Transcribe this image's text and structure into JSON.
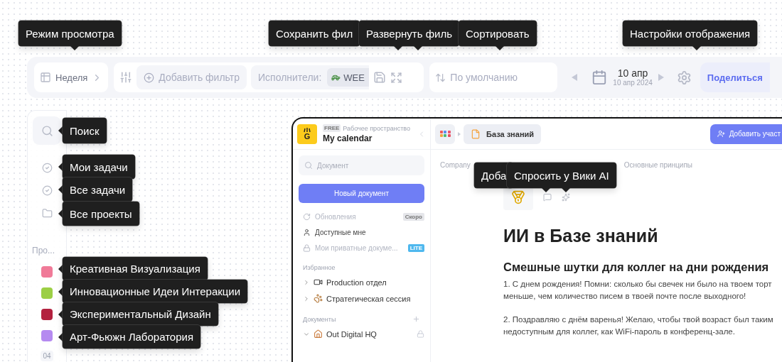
{
  "toolbar_tooltips": [
    "Режим просмотра",
    "Сохранить фил",
    "Развернуть филь",
    "Сортировать",
    "Настройки отображения"
  ],
  "toolbar": {
    "view_mode": "Неделя",
    "add_filter": "Добавить фильтр",
    "assignee_label": "Исполнители:",
    "assignee_chip": "WEE",
    "sort": "По умолчанию",
    "date": "10 апр",
    "date_full": "10 апр 2024",
    "share_button": "Поделиться"
  },
  "sidebar": {
    "search_tooltip": "Поиск",
    "nav": [
      {
        "kind": "check",
        "tooltip": "Мои задачи"
      },
      {
        "kind": "check",
        "tooltip": "Все задачи"
      },
      {
        "kind": "folder",
        "tooltip": "Все проекты"
      }
    ],
    "section_label": "Про...",
    "projects": [
      {
        "name": "Креативная Визуализация",
        "color": "#f07a98"
      },
      {
        "name": "Инновационные Идеи Интеракции",
        "color": "#9ccf45"
      },
      {
        "name": "Экспериментальный Дизайн",
        "color": "#b3213f"
      },
      {
        "name": "Арт-Фьюжн Лаборатория",
        "color": "#b58af0"
      }
    ],
    "footer": "04"
  },
  "workspace": {
    "logo_text": "G",
    "plan_badge": "FREE",
    "workspace_label": "Рабочее пространство",
    "workspace_name": "My calendar",
    "search": {
      "placeholder": "Документ"
    },
    "new_button": "Новый документ",
    "menu": [
      {
        "kind": "updates",
        "label": "Обновления",
        "disabled": true,
        "badge": "Скоро"
      },
      {
        "kind": "shared",
        "label": "Доступные мне",
        "disabled": false
      },
      {
        "kind": "private",
        "label": "Мои приватные докуме...",
        "disabled": true,
        "badge": "LITE"
      }
    ],
    "favorites_title": "Избранное",
    "favorites": [
      {
        "kind": "video",
        "label": "Production отдел",
        "expanded": false
      },
      {
        "kind": "bear",
        "label": "Стратегическая сессия",
        "expanded": false
      }
    ],
    "documents_title": "Документы",
    "documents": [
      {
        "kind": "house",
        "label": "Out Digital HQ",
        "expanded": true,
        "locked": true
      }
    ]
  },
  "main": {
    "breadcrumb_chip": "База знаний",
    "add_button": "Добавить участ",
    "path": [
      "Company",
      "Основные принципы"
    ],
    "tooltips": [
      "Доба",
      "Спросить у Вики AI"
    ],
    "title": "ИИ в Базе знаний",
    "heading": "Смешные шутки для коллег на дни рождения",
    "paragraphs": [
      {
        "lines": [
          "1. С днем рождения! Помни: сколько бы свечек ни было на твоем торт",
          "меньше, чем количество писем в твоей почте после выходного!"
        ]
      },
      {
        "lines": [
          "2. Поздравляю с днём варенья! Желаю, чтобы твой возраст был таким",
          "недоступным для коллег, как WiFi-пароль в конференц-зале."
        ]
      }
    ]
  }
}
